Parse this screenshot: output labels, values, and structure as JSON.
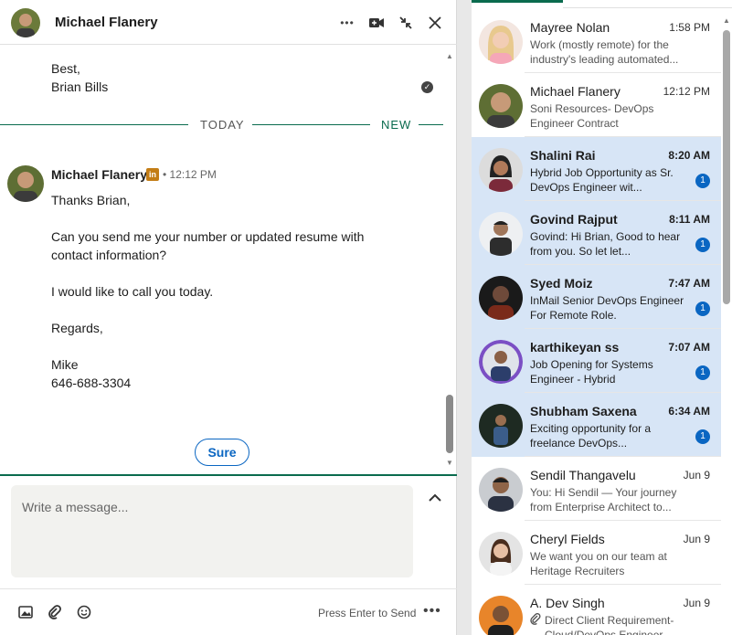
{
  "chat": {
    "header": {
      "name": "Michael Flanery",
      "more_label": "•••"
    },
    "previous_signature": [
      "Best,",
      "Brian Bills"
    ],
    "divider": {
      "today": "TODAY",
      "new": "NEW"
    },
    "message": {
      "sender": "Michael Flanery",
      "badge": "in",
      "time": "• 12:12 PM",
      "lines": [
        "Thanks Brian,",
        "Can you send me your number or updated resume with",
        "contact information?",
        "I would like to call you today.",
        "Regards,",
        "Mike",
        "646-688-3304"
      ]
    },
    "quick_reply": "Sure",
    "compose": {
      "placeholder": "Write a message..."
    },
    "footer": {
      "press_enter": "Press Enter to Send",
      "more_label": "•••"
    }
  },
  "conversations": [
    {
      "name": "Mayree Nolan",
      "time": "1:58 PM",
      "snippet": "Work (mostly remote) for the industry's leading automated...",
      "unread": false,
      "badge": ""
    },
    {
      "name": "Michael Flanery",
      "time": "12:12 PM",
      "snippet": "Soni Resources- DevOps Engineer Contract",
      "unread": false,
      "badge": ""
    },
    {
      "name": "Shalini Rai",
      "time": "8:20 AM",
      "snippet": "Hybrid Job Opportunity as Sr. DevOps Engineer wit...",
      "unread": true,
      "badge": "1"
    },
    {
      "name": "Govind Rajput",
      "time": "8:11 AM",
      "snippet": "Govind: Hi Brian, Good to hear from you. So let let...",
      "unread": true,
      "badge": "1"
    },
    {
      "name": "Syed Moiz",
      "time": "7:47 AM",
      "snippet": "InMail  Senior DevOps Engineer For Remote Role.",
      "unread": true,
      "badge": "1"
    },
    {
      "name": "karthikeyan ss",
      "time": "7:07 AM",
      "snippet": "Job Opening for Systems Engineer - Hybrid",
      "unread": true,
      "badge": "1"
    },
    {
      "name": "Shubham Saxena",
      "time": "6:34 AM",
      "snippet": "Exciting opportunity for a freelance DevOps...",
      "unread": true,
      "badge": "1"
    },
    {
      "name": "Sendil Thangavelu",
      "time": "Jun 9",
      "snippet": "You: Hi Sendil — Your journey from Enterprise Architect to...",
      "unread": false,
      "badge": ""
    },
    {
      "name": "Cheryl Fields",
      "time": "Jun 9",
      "snippet": "We want you on our team at Heritage Recruiters",
      "unread": false,
      "badge": ""
    },
    {
      "name": "A. Dev Singh",
      "time": "Jun 9",
      "snippet": "Direct Client Requirement- Cloud/DevOps Engineer...",
      "unread": false,
      "badge": ""
    }
  ],
  "colors": {
    "accent_green": "#0a6b4e",
    "link_blue": "#0a66c2",
    "unread_bg": "#d7e5f6"
  }
}
